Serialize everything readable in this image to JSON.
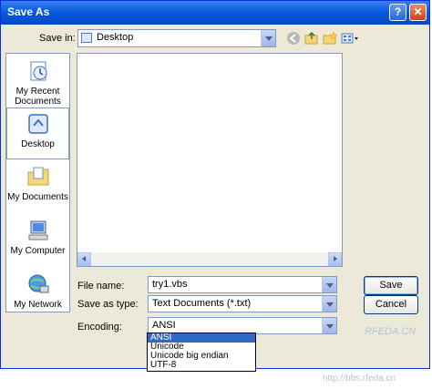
{
  "window": {
    "title": "Save As",
    "help_glyph": "?",
    "close_glyph": "✕"
  },
  "toolbar": {
    "save_in_label": "Save in:",
    "save_in_value": "Desktop",
    "icons": [
      "back-icon",
      "up-folder-icon",
      "new-folder-icon",
      "views-menu-icon"
    ]
  },
  "places": [
    {
      "label": "My Recent Documents",
      "icon": "recent-documents-icon"
    },
    {
      "label": "Desktop",
      "icon": "desktop-icon"
    },
    {
      "label": "My Documents",
      "icon": "my-documents-icon"
    },
    {
      "label": "My Computer",
      "icon": "my-computer-icon"
    },
    {
      "label": "My Network",
      "icon": "my-network-icon"
    }
  ],
  "form": {
    "file_name_label": "File name:",
    "file_name_value": "try1.vbs",
    "save_as_type_label": "Save as type:",
    "save_as_type_value": "Text Documents (*.txt)",
    "encoding_label": "Encoding:",
    "encoding_value": "ANSI",
    "encoding_options": [
      "ANSI",
      "Unicode",
      "Unicode big endian",
      "UTF-8"
    ],
    "encoding_selected": "ANSI"
  },
  "buttons": {
    "save": "Save",
    "cancel": "Cancel"
  },
  "watermark": {
    "site": "RFEDA.CN",
    "url": "http://bbs.rfeda.cn"
  }
}
